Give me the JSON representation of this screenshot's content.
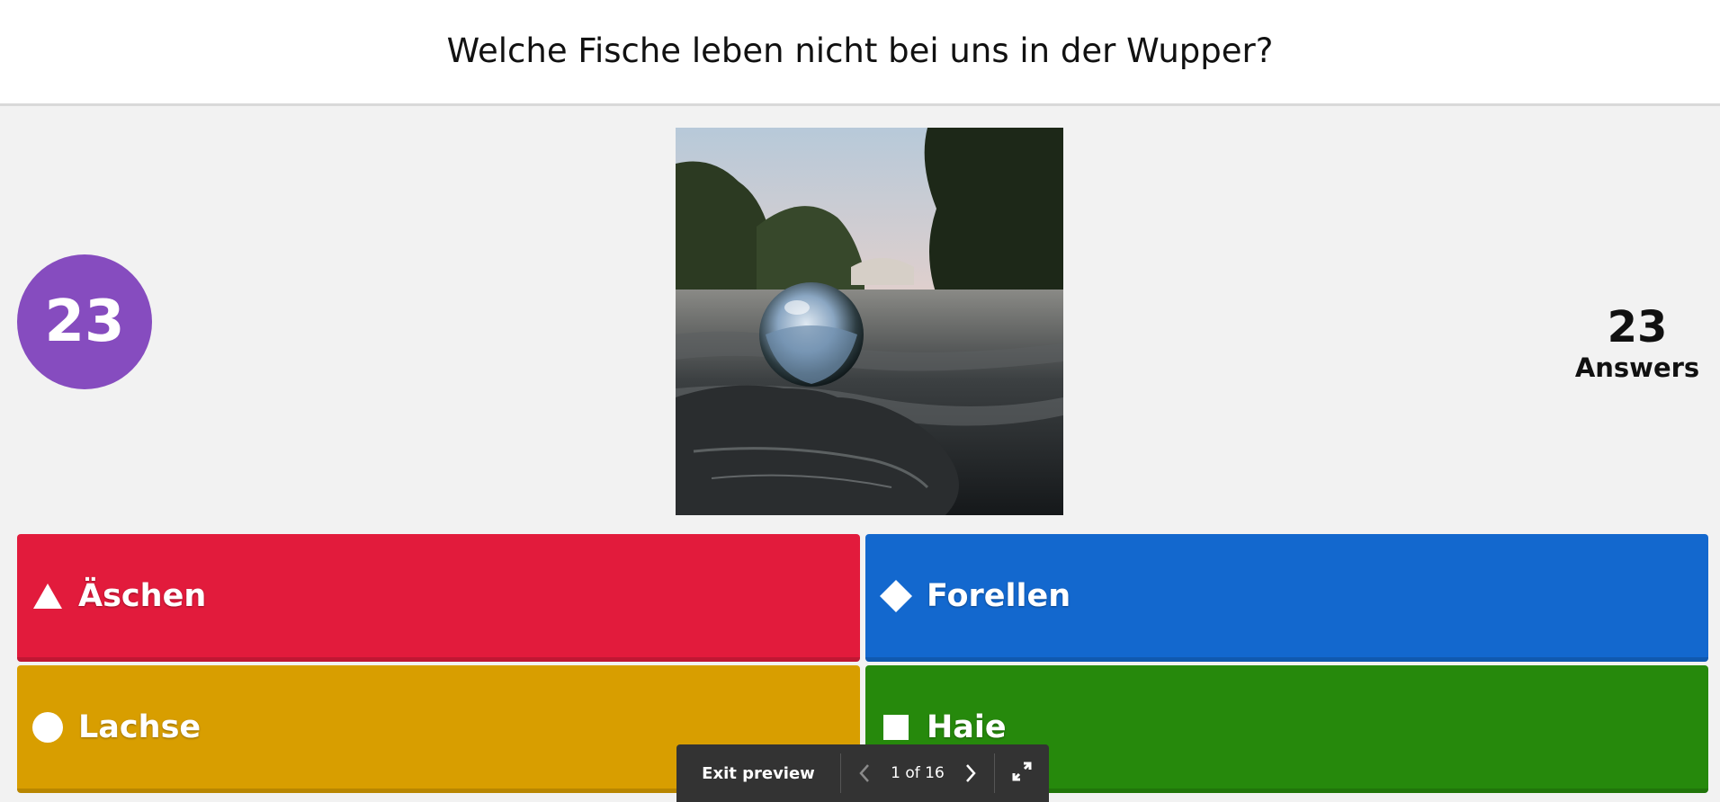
{
  "question": "Welche Fische leben nicht bei uns in der Wupper?",
  "timer": "23",
  "answers_count": {
    "number": "23",
    "label": "Answers"
  },
  "image": {
    "description_icon": "river-photo"
  },
  "answers": [
    {
      "shape": "triangle-icon",
      "label": "Äschen",
      "color": "#e21b3c"
    },
    {
      "shape": "diamond-icon",
      "label": "Forellen",
      "color": "#1368ce"
    },
    {
      "shape": "circle-icon",
      "label": "Lachse",
      "color": "#d89e00"
    },
    {
      "shape": "square-icon",
      "label": "Haie",
      "color": "#26890c"
    }
  ],
  "preview_bar": {
    "exit_label": "Exit preview",
    "page_label": "1 of 16"
  },
  "colors": {
    "timer": "#864cbf",
    "bar": "#333333",
    "background": "#f2f2f2"
  }
}
